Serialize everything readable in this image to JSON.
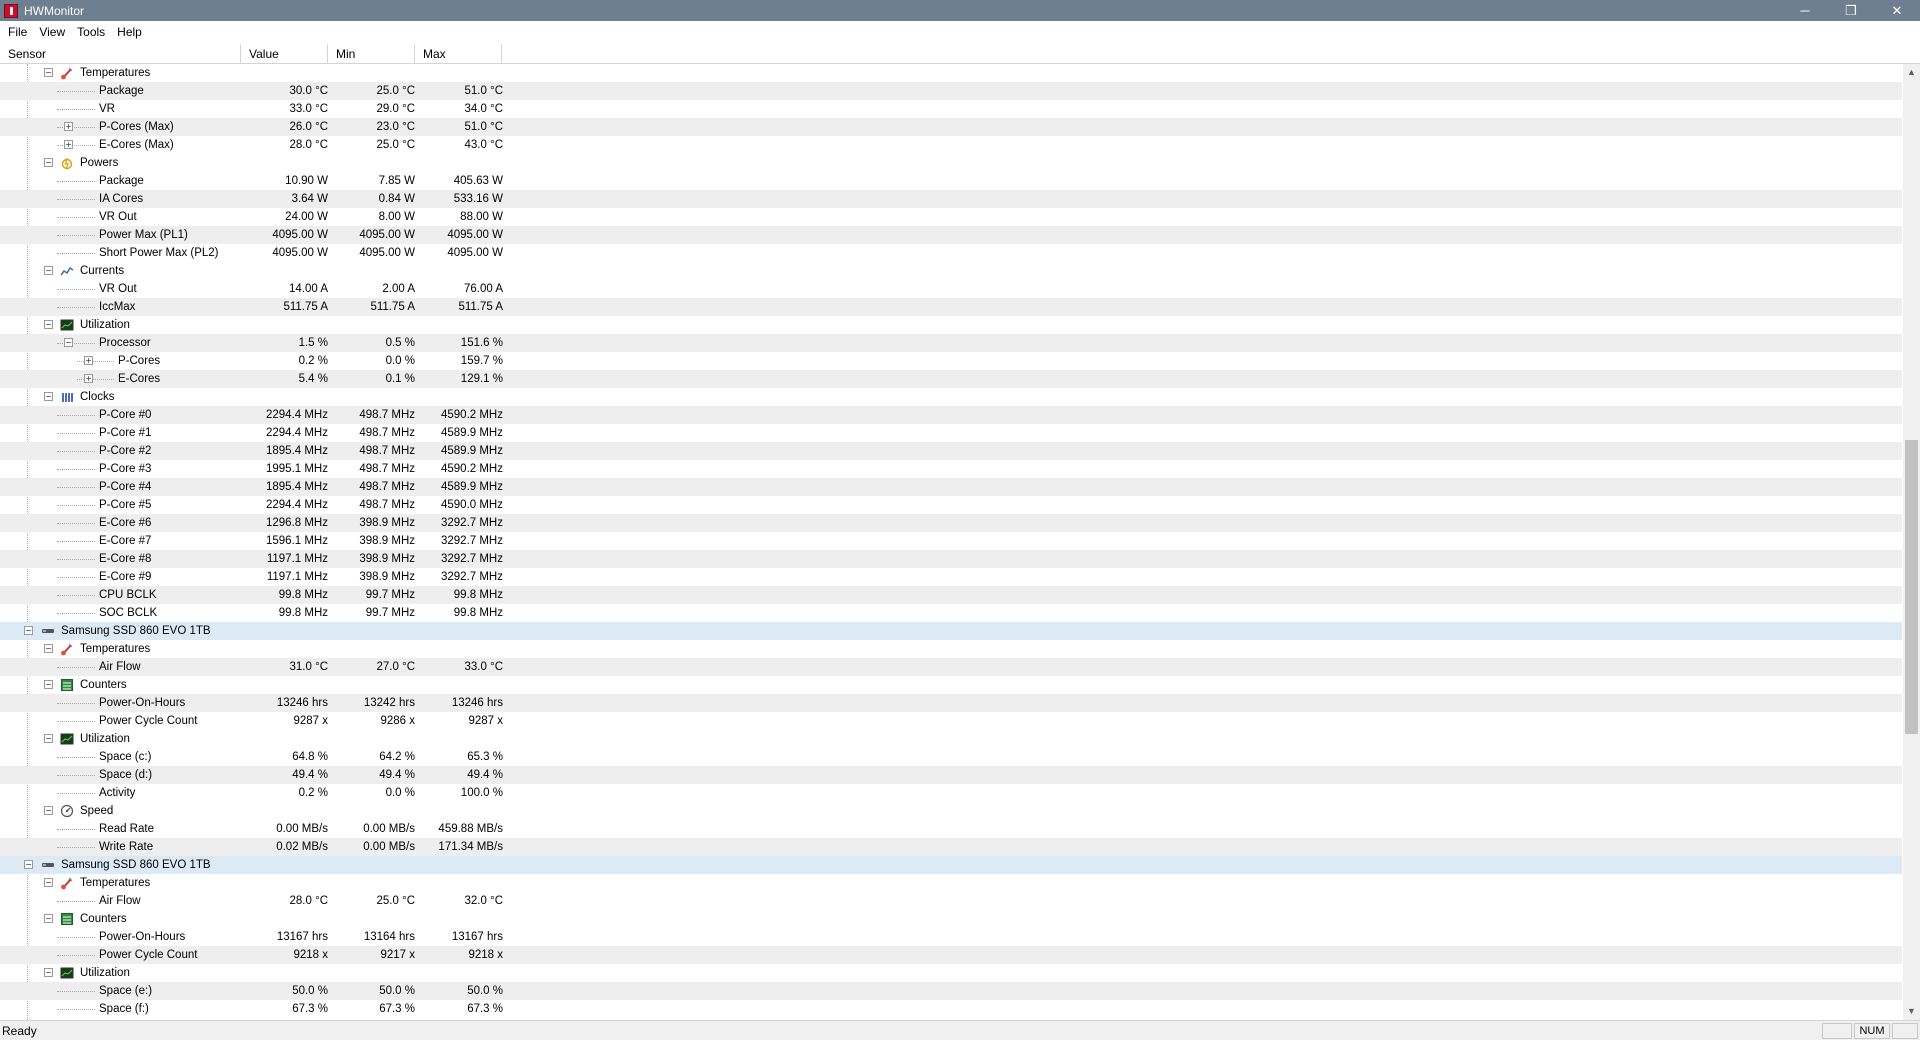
{
  "window": {
    "title": "HWMonitor",
    "minimize": "─",
    "restore": "❐",
    "close": "✕"
  },
  "menu": [
    "File",
    "View",
    "Tools",
    "Help"
  ],
  "columns": [
    "Sensor",
    "Value",
    "Min",
    "Max"
  ],
  "rows": [
    {
      "type": "group",
      "icon": "thermometer-icon",
      "level": 1,
      "label": "Temperatures"
    },
    {
      "level": 2,
      "label": "Package",
      "value": "30.0 °C",
      "min": "25.0 °C",
      "max": "51.0 °C"
    },
    {
      "level": 2,
      "label": "VR",
      "value": "33.0 °C",
      "min": "29.0 °C",
      "max": "34.0 °C"
    },
    {
      "level": 2,
      "expand": true,
      "label": "P-Cores (Max)",
      "value": "26.0 °C",
      "min": "23.0 °C",
      "max": "51.0 °C"
    },
    {
      "level": 2,
      "expand": true,
      "label": "E-Cores (Max)",
      "value": "28.0 °C",
      "min": "25.0 °C",
      "max": "43.0 °C"
    },
    {
      "type": "group",
      "icon": "power-icon",
      "level": 1,
      "label": "Powers"
    },
    {
      "level": 2,
      "label": "Package",
      "value": "10.90 W",
      "min": "7.85 W",
      "max": "405.63 W"
    },
    {
      "level": 2,
      "label": "IA Cores",
      "value": "3.64 W",
      "min": "0.84 W",
      "max": "533.16 W"
    },
    {
      "level": 2,
      "label": "VR Out",
      "value": "24.00 W",
      "min": "8.00 W",
      "max": "88.00 W"
    },
    {
      "level": 2,
      "label": "Power Max (PL1)",
      "value": "4095.00 W",
      "min": "4095.00 W",
      "max": "4095.00 W"
    },
    {
      "level": 2,
      "label": "Short Power Max (PL2)",
      "value": "4095.00 W",
      "min": "4095.00 W",
      "max": "4095.00 W"
    },
    {
      "type": "group",
      "icon": "current-icon",
      "level": 1,
      "label": "Currents"
    },
    {
      "level": 2,
      "label": "VR Out",
      "value": "14.00 A",
      "min": "2.00 A",
      "max": "76.00 A"
    },
    {
      "level": 2,
      "label": "IccMax",
      "value": "511.75 A",
      "min": "511.75 A",
      "max": "511.75 A"
    },
    {
      "type": "group",
      "icon": "utilization-icon",
      "level": 1,
      "label": "Utilization"
    },
    {
      "level": 2,
      "collapse": true,
      "label": "Processor",
      "value": "1.5 %",
      "min": "0.5 %",
      "max": "151.6 %"
    },
    {
      "level": 3,
      "expand": true,
      "label": "P-Cores",
      "value": "0.2 %",
      "min": "0.0 %",
      "max": "159.7 %"
    },
    {
      "level": 3,
      "expand": true,
      "label": "E-Cores",
      "value": "5.4 %",
      "min": "0.1 %",
      "max": "129.1 %"
    },
    {
      "type": "group",
      "icon": "clock-icon",
      "level": 1,
      "label": "Clocks"
    },
    {
      "level": 2,
      "label": "P-Core #0",
      "value": "2294.4 MHz",
      "min": "498.7 MHz",
      "max": "4590.2 MHz"
    },
    {
      "level": 2,
      "label": "P-Core #1",
      "value": "2294.4 MHz",
      "min": "498.7 MHz",
      "max": "4589.9 MHz"
    },
    {
      "level": 2,
      "label": "P-Core #2",
      "value": "1895.4 MHz",
      "min": "498.7 MHz",
      "max": "4589.9 MHz"
    },
    {
      "level": 2,
      "label": "P-Core #3",
      "value": "1995.1 MHz",
      "min": "498.7 MHz",
      "max": "4590.2 MHz"
    },
    {
      "level": 2,
      "label": "P-Core #4",
      "value": "1895.4 MHz",
      "min": "498.7 MHz",
      "max": "4589.9 MHz"
    },
    {
      "level": 2,
      "label": "P-Core #5",
      "value": "2294.4 MHz",
      "min": "498.7 MHz",
      "max": "4590.0 MHz"
    },
    {
      "level": 2,
      "label": "E-Core #6",
      "value": "1296.8 MHz",
      "min": "398.9 MHz",
      "max": "3292.7 MHz"
    },
    {
      "level": 2,
      "label": "E-Core #7",
      "value": "1596.1 MHz",
      "min": "398.9 MHz",
      "max": "3292.7 MHz"
    },
    {
      "level": 2,
      "label": "E-Core #8",
      "value": "1197.1 MHz",
      "min": "398.9 MHz",
      "max": "3292.7 MHz"
    },
    {
      "level": 2,
      "label": "E-Core #9",
      "value": "1197.1 MHz",
      "min": "398.9 MHz",
      "max": "3292.7 MHz"
    },
    {
      "level": 2,
      "label": "CPU BCLK",
      "value": "99.8 MHz",
      "min": "99.7 MHz",
      "max": "99.8 MHz"
    },
    {
      "level": 2,
      "label": "SOC BCLK",
      "value": "99.8 MHz",
      "min": "99.7 MHz",
      "max": "99.8 MHz"
    },
    {
      "type": "device",
      "icon": "drive-icon",
      "level": 0,
      "label": "Samsung SSD 860 EVO 1TB"
    },
    {
      "type": "group",
      "icon": "thermometer-icon",
      "level": 1,
      "label": "Temperatures"
    },
    {
      "level": 2,
      "label": "Air Flow",
      "value": "31.0 °C",
      "min": "27.0 °C",
      "max": "33.0 °C"
    },
    {
      "type": "group",
      "icon": "counter-icon",
      "level": 1,
      "label": "Counters"
    },
    {
      "level": 2,
      "label": "Power-On-Hours",
      "value": "13246 hrs",
      "min": "13242 hrs",
      "max": "13246 hrs"
    },
    {
      "level": 2,
      "label": "Power Cycle Count",
      "value": "9287 x",
      "min": "9286 x",
      "max": "9287 x"
    },
    {
      "type": "group",
      "icon": "utilization-icon",
      "level": 1,
      "label": "Utilization"
    },
    {
      "level": 2,
      "label": "Space (c:)",
      "value": "64.8 %",
      "min": "64.2 %",
      "max": "65.3 %"
    },
    {
      "level": 2,
      "label": "Space (d:)",
      "value": "49.4 %",
      "min": "49.4 %",
      "max": "49.4 %"
    },
    {
      "level": 2,
      "label": "Activity",
      "value": "0.2 %",
      "min": "0.0 %",
      "max": "100.0 %"
    },
    {
      "type": "group",
      "icon": "speed-icon",
      "level": 1,
      "label": "Speed"
    },
    {
      "level": 2,
      "label": "Read Rate",
      "value": "0.00 MB/s",
      "min": "0.00 MB/s",
      "max": "459.88 MB/s"
    },
    {
      "level": 2,
      "label": "Write Rate",
      "value": "0.02 MB/s",
      "min": "0.00 MB/s",
      "max": "171.34 MB/s"
    },
    {
      "type": "device",
      "icon": "drive-icon",
      "level": 0,
      "label": "Samsung SSD 860 EVO 1TB"
    },
    {
      "type": "group",
      "icon": "thermometer-icon",
      "level": 1,
      "label": "Temperatures"
    },
    {
      "level": 2,
      "label": "Air Flow",
      "value": "28.0 °C",
      "min": "25.0 °C",
      "max": "32.0 °C"
    },
    {
      "type": "group",
      "icon": "counter-icon",
      "level": 1,
      "label": "Counters"
    },
    {
      "level": 2,
      "label": "Power-On-Hours",
      "value": "13167 hrs",
      "min": "13164 hrs",
      "max": "13167 hrs"
    },
    {
      "level": 2,
      "label": "Power Cycle Count",
      "value": "9218 x",
      "min": "9217 x",
      "max": "9218 x"
    },
    {
      "type": "group",
      "icon": "utilization-icon",
      "level": 1,
      "label": "Utilization"
    },
    {
      "level": 2,
      "label": "Space (e:)",
      "value": "50.0 %",
      "min": "50.0 %",
      "max": "50.0 %"
    },
    {
      "level": 2,
      "label": "Space (f:)",
      "value": "67.3 %",
      "min": "67.3 %",
      "max": "67.3 %"
    }
  ],
  "status": {
    "text": "Ready",
    "num": "NUM"
  }
}
